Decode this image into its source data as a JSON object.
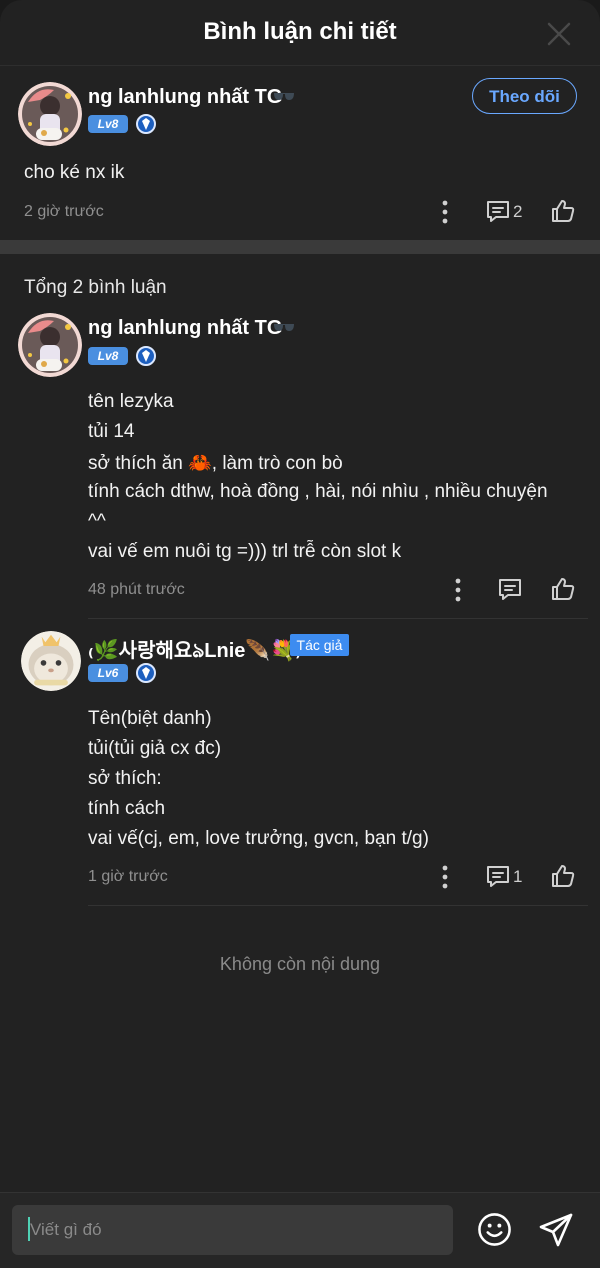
{
  "header": {
    "title": "Bình luận chi tiết",
    "close_icon": "close-icon"
  },
  "main_post": {
    "username": "ng lanhlung nhất TG",
    "level": "Lv8",
    "follow_label": "Theo dõi",
    "text": "cho ké nx ik",
    "time": "2 giờ trước",
    "reply_count": "2"
  },
  "comments_section": {
    "total_label": "Tổng 2 bình luận",
    "end_label": "Không còn nội dung"
  },
  "comments": [
    {
      "username": "ng lanhlung nhất TG",
      "level": "Lv8",
      "lines": [
        "tên lezyka",
        "tủi 14",
        "sở thích ăn 🦀, làm trò con bò",
        "tính cách dthw, hoà đồng , hài, nói nhìu , nhiều chuyện",
        "^^",
        "vai vế em nuôi tg =))) trl trễ còn slot k"
      ],
      "time": "48 phút trước",
      "reply_count": ""
    },
    {
      "username": "₍🌿사랑해요ঌLnie🪶💐₎",
      "level": "Lv6",
      "author_tag": "Tác giả",
      "lines": [
        "Tên(biệt danh)",
        "tủi(tủi giả cx đc)",
        "sở thích:",
        "tính cách",
        "vai vế(cj, em, love trưởng, gvcn, bạn t/g)"
      ],
      "time": "1 giờ trước",
      "reply_count": "1"
    }
  ],
  "composer": {
    "placeholder": "Viết gì đó",
    "emoji_icon": "smiley-icon",
    "send_icon": "send-icon"
  },
  "colors": {
    "accent": "#6aa8ff",
    "badge_blue": "#4a8fe0",
    "background": "#222222",
    "caret": "#4fd1b5"
  }
}
